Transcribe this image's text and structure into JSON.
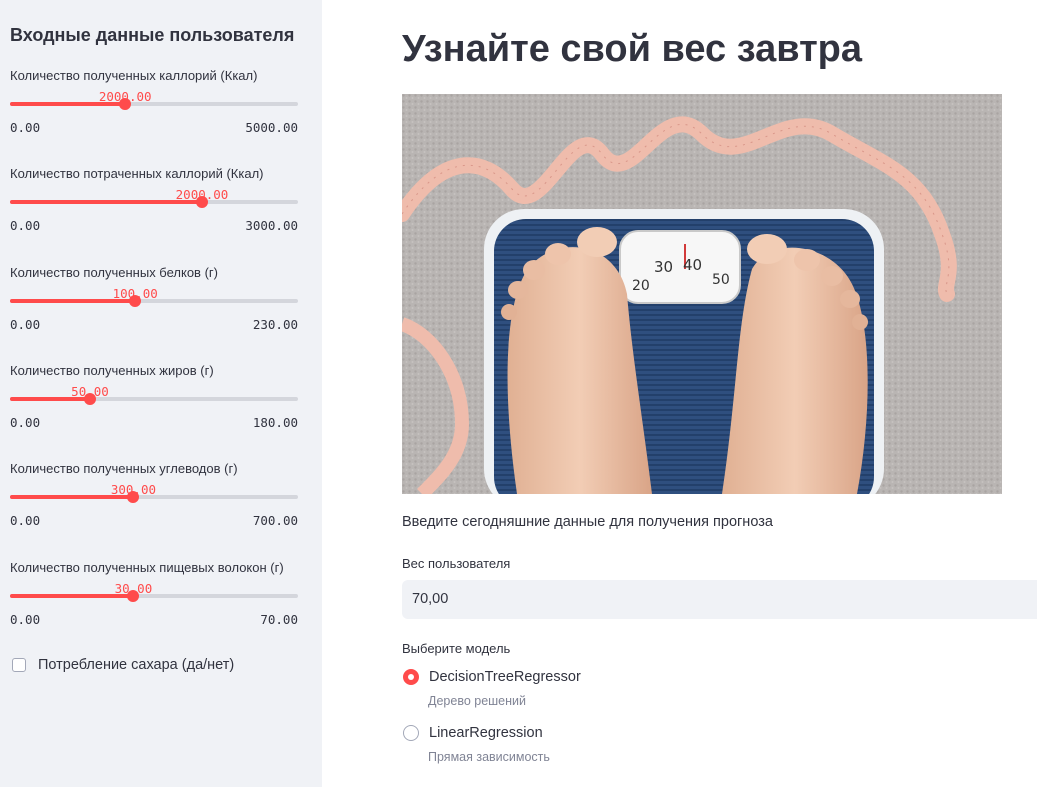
{
  "sidebar": {
    "title": "Входные данные пользователя",
    "sliders": [
      {
        "label": "Количество полученных каллорий (Ккал)",
        "value": 2000,
        "value_text": "2000.00",
        "min": 0,
        "max": 5000,
        "min_text": "0.00",
        "max_text": "5000.00"
      },
      {
        "label": "Количество потраченных каллорий (Ккал)",
        "value": 2000,
        "value_text": "2000.00",
        "min": 0,
        "max": 3000,
        "min_text": "0.00",
        "max_text": "3000.00"
      },
      {
        "label": "Количество полученных белков (г)",
        "value": 100,
        "value_text": "100.00",
        "min": 0,
        "max": 230,
        "min_text": "0.00",
        "max_text": "230.00"
      },
      {
        "label": "Количество полученных жиров (г)",
        "value": 50,
        "value_text": "50.00",
        "min": 0,
        "max": 180,
        "min_text": "0.00",
        "max_text": "180.00"
      },
      {
        "label": "Количество полученных углеводов (г)",
        "value": 300,
        "value_text": "300.00",
        "min": 0,
        "max": 700,
        "min_text": "0.00",
        "max_text": "700.00"
      },
      {
        "label": "Количество полученных пищевых волокон (г)",
        "value": 30,
        "value_text": "30.00",
        "min": 0,
        "max": 70,
        "min_text": "0.00",
        "max_text": "70.00"
      }
    ],
    "checkbox": {
      "label": "Потребление сахара (да/нет)",
      "checked": false
    }
  },
  "main": {
    "title": "Узнайте свой вес завтра",
    "image": {
      "scale_numbers": [
        "20",
        "30",
        "40",
        "50"
      ]
    },
    "intro": "Введите сегодняшние данные для получения прогноза",
    "weight": {
      "label": "Вес пользователя",
      "value": "70,00"
    },
    "model": {
      "label": "Выберите модель",
      "options": [
        {
          "label": "DecisionTreeRegressor",
          "caption": "Дерево решений",
          "selected": true
        },
        {
          "label": "LinearRegression",
          "caption": "Прямая зависимость",
          "selected": false
        }
      ]
    }
  },
  "colors": {
    "accent": "#ff4b4b",
    "sidebar_bg": "#f0f2f6",
    "text": "#31333f"
  }
}
